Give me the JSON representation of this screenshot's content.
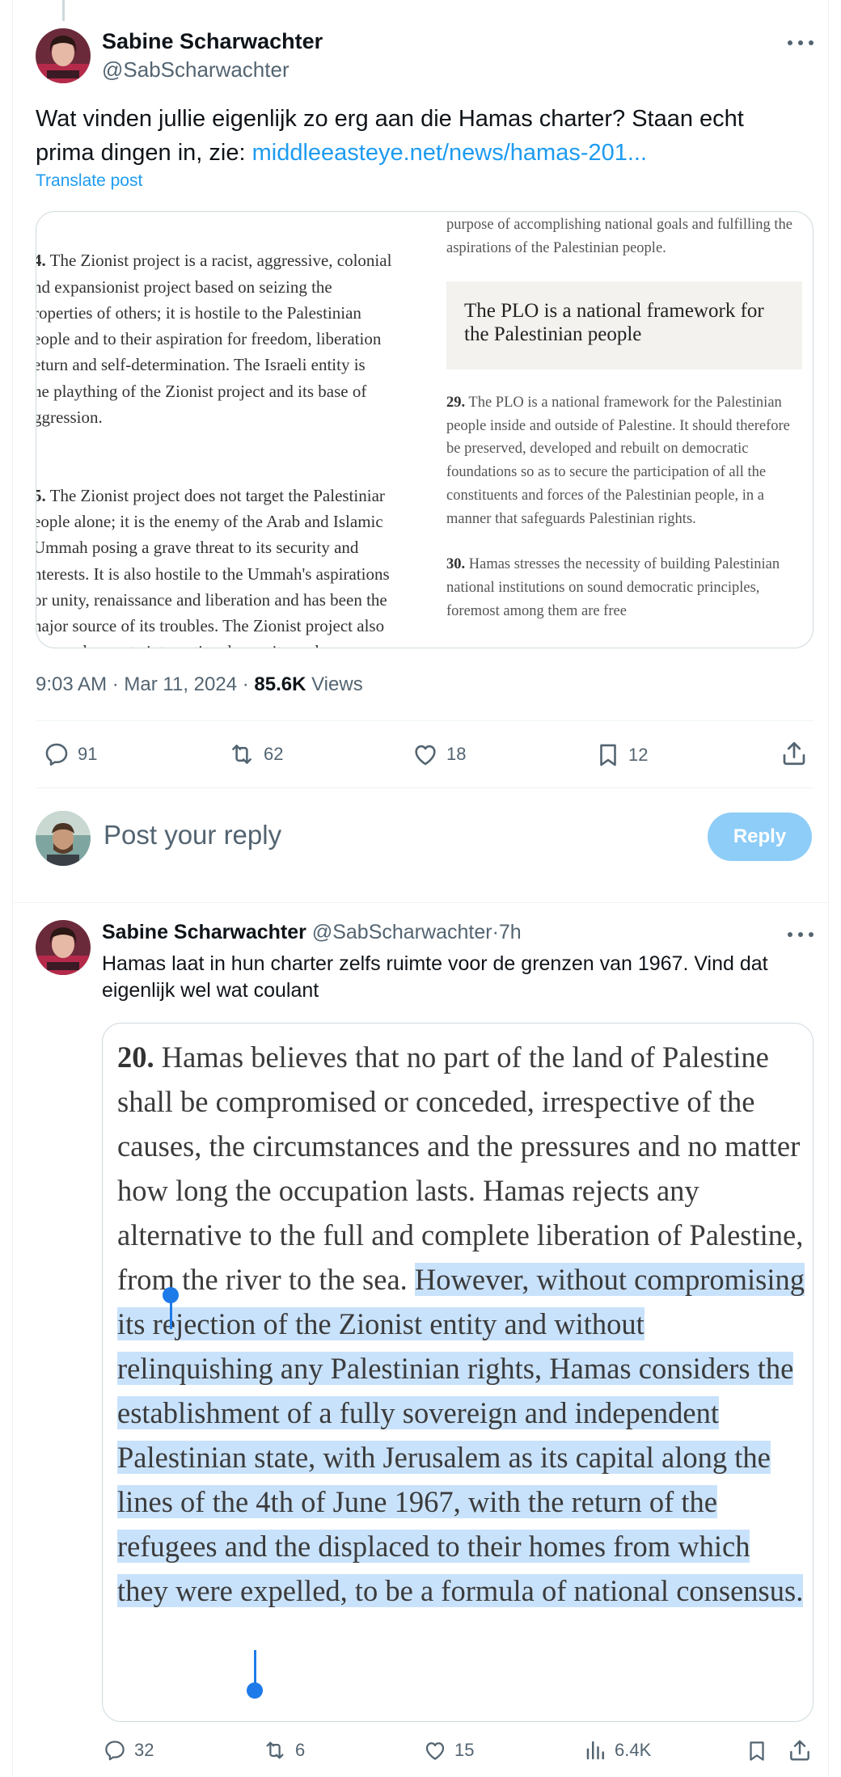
{
  "post": {
    "author_name": "Sabine Scharwachter",
    "author_handle": "@SabScharwachter",
    "text": "Wat vinden jullie eigenlijk zo erg aan die Hamas charter? Staan echt prima dingen in, zie: ",
    "link": "middleeasteye.net/news/hamas-201...",
    "translate_label": "Translate post",
    "card": {
      "left_column": {
        "item4_num": "4.",
        "item4_text": " The Zionist project is a racist, aggressive, colonial\nnd expansionist project based on seizing the\nroperties of others; it is hostile to the Palestinian\neople and to their aspiration for freedom, liberation\neturn and self-determination. The Israeli entity is\nhe plaything of the Zionist project and its base of\nggression.",
        "item5_num": "5.",
        "item5_text": " The Zionist project does not target the Palestiniar\neople alone; it is the enemy of the Arab and Islamic\nUmmah posing a grave threat to its security and\nnterests. It is also hostile to the Ummah's aspirations\nor unity, renaissance and liberation and has been the\nnajor source of its troubles. The Zionist project also\noses a danger to international security and peace\nnd to mankind and its interests and stability."
      },
      "right_column": {
        "top_text": "purpose of accomplishing national goals and fulfilling the aspirations of the Palestinian people.",
        "box_heading": "The PLO is a national framework for the Palestinian people",
        "item29_num": "29.",
        "item29_text": " The PLO is a national framework for the Palestinian people inside and outside of Palestine.  It should therefore be preserved, developed and rebuilt on democratic foundations so as to secure the participation of all the constituents and forces of the Palestinian people, in a manner that safeguards Palestinian rights.",
        "item30_num": "30.",
        "item30_text": " Hamas stresses the necessity of building Palestinian national institutions on sound democratic principles, foremost among them are free"
      }
    },
    "time": "9:03 AM",
    "date": "Mar 11, 2024",
    "views_count": "85.6K",
    "views_label": "Views",
    "separator": "·",
    "actions": {
      "replies": "91",
      "reposts": "62",
      "likes": "18",
      "bookmarks": "12"
    }
  },
  "reply_box": {
    "placeholder": "Post your reply",
    "button_label": "Reply"
  },
  "reply_post": {
    "author_name": "Sabine Scharwachter",
    "author_handle": "@SabScharwachter",
    "time_ago": "7h",
    "separator": "·",
    "text": "Hamas laat in hun charter zelfs ruimte voor de grenzen van 1967. Vind dat eigenlijk wel wat coulant",
    "quote": {
      "num": "20.",
      "text_before": " Hamas believes that no part of the land of Palestine shall be compromised or conceded, irrespective of the causes, the circumstances and the pressures and no matter how long the occupation lasts. Hamas rejects any alternative to the full and complete liberation of Palestine, from the river to the sea. ",
      "text_selected": "However, without compromising its rejection of the Zionist entity and without relinquishing any Palestinian rights, Hamas considers the establishment of a fully sovereign and independent Palestinian state, with Jerusalem as its capital along the lines of the 4th of June 1967, with the return of the refugees and the displaced to their homes from which they were expelled, to be a formula of national consensus."
    },
    "actions": {
      "replies": "32",
      "reposts": "6",
      "likes": "15",
      "views": "6.4K"
    }
  },
  "colors": {
    "accent": "#1d9bf0",
    "reply_button": "#8ecdf8",
    "selection": "#c9e2fb",
    "selection_handle": "#1d7ae8",
    "secondary_text": "#536471"
  },
  "icons": [
    "more-icon",
    "reply-icon",
    "repost-icon",
    "like-icon",
    "bookmark-icon",
    "share-icon",
    "views-icon"
  ]
}
